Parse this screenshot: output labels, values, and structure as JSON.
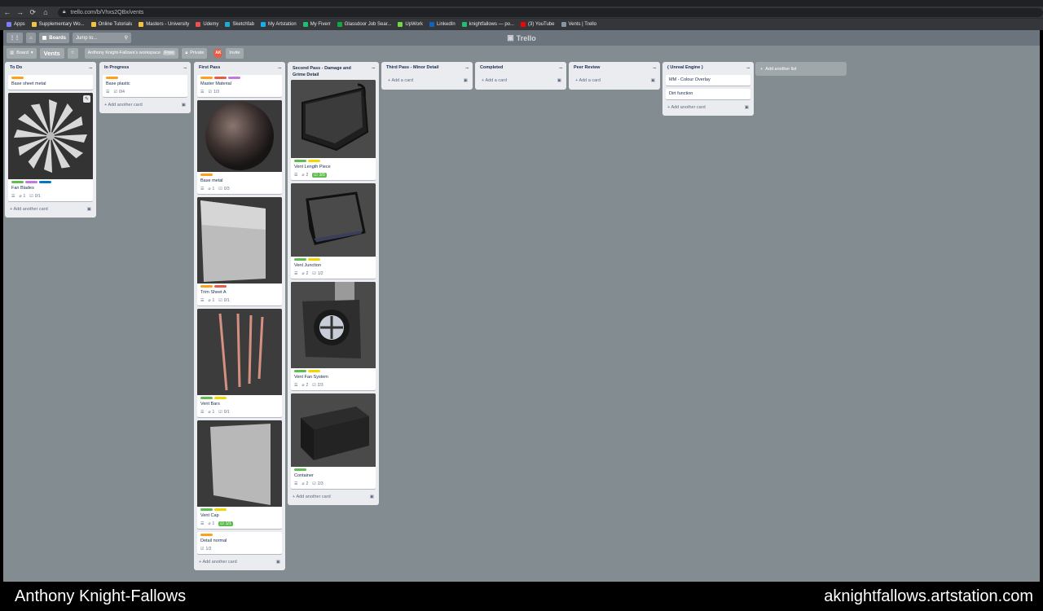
{
  "browser": {
    "url": "trello.com/b/Vhxs2QBx/vents",
    "bookmarks": [
      {
        "label": "Apps",
        "color": "#7d7dff"
      },
      {
        "label": "Supplementary Wo...",
        "color": "#f4c242"
      },
      {
        "label": "Online Tutorials",
        "color": "#f4c242"
      },
      {
        "label": "Masters - University",
        "color": "#f4c242"
      },
      {
        "label": "Udemy",
        "color": "#ec5252"
      },
      {
        "label": "Sketchfab",
        "color": "#1caad9"
      },
      {
        "label": "My Artstation",
        "color": "#13aff0"
      },
      {
        "label": "My Fiverr",
        "color": "#1dbf73"
      },
      {
        "label": "Glassdoor Job Sear...",
        "color": "#0caa41"
      },
      {
        "label": "UpWork",
        "color": "#6fda44"
      },
      {
        "label": "LinkedIn",
        "color": "#0a66c2"
      },
      {
        "label": "knightfallows — po...",
        "color": "#1dbf73"
      },
      {
        "label": "(3) YouTube",
        "color": "#ff0000"
      },
      {
        "label": "Vents | Trello",
        "color": "#8a94a6"
      }
    ]
  },
  "header": {
    "boards_label": "Boards",
    "jump_placeholder": "Jump to...",
    "logo": "Trello"
  },
  "board_header": {
    "view_label": "Board",
    "board_name": "Vents",
    "workspace": "Anthony Knight-Fallows's workspace",
    "workspace_tag": "Free",
    "visibility": "Private",
    "avatar": "AK",
    "invite": "Invite",
    "add_list": "Add another list"
  },
  "colors": {
    "orange": "#ff9f1a",
    "red": "#eb5a46",
    "purple": "#c377e0",
    "blue": "#0079bf",
    "green": "#61bd4f",
    "yellow": "#f2d600"
  },
  "lists": [
    {
      "title": "To Do",
      "add": "Add another card",
      "cards": [
        {
          "title": "Base sheet metal",
          "labels": [
            "orange"
          ]
        },
        {
          "title": "Fan Blades",
          "labels": [
            "green",
            "purple",
            "blue"
          ],
          "cover": "fan",
          "desc": true,
          "attach": "1",
          "check": "0/1"
        }
      ]
    },
    {
      "title": "In Progress",
      "add": "Add another card",
      "cards": [
        {
          "title": "Base plastic",
          "labels": [
            "orange"
          ],
          "desc": true,
          "check": "0/4"
        }
      ]
    },
    {
      "title": "First Pass",
      "add": "Add another card",
      "cards": [
        {
          "title": "Master Material",
          "labels": [
            "orange",
            "red",
            "purple"
          ],
          "desc": true,
          "check": "1/3"
        },
        {
          "title": "Base metal",
          "labels": [
            "orange"
          ],
          "cover": "sphere",
          "desc": true,
          "attach": "1",
          "check": "0/3"
        },
        {
          "title": "Trim Sheet A",
          "labels": [
            "orange",
            "red"
          ],
          "cover": "plate",
          "desc": true,
          "attach": "1",
          "check": "0/1"
        },
        {
          "title": "Vent Bars",
          "labels": [
            "green",
            "yellow"
          ],
          "cover": "bars",
          "desc": true,
          "attach": "1",
          "check": "0/1"
        },
        {
          "title": "Vent Cap",
          "labels": [
            "green",
            "yellow"
          ],
          "cover": "cap",
          "desc": true,
          "attach": "1",
          "check": "1/1",
          "done": true
        },
        {
          "title": "Detail normal",
          "labels": [
            "orange"
          ],
          "check": "1/2"
        }
      ]
    },
    {
      "title": "Second Pass - Damage and Grime Detail",
      "add": "Add another card",
      "cards": [
        {
          "title": "Vent Length Piece",
          "labels": [
            "green",
            "yellow"
          ],
          "cover": "length",
          "desc": true,
          "attach": "2",
          "check": "3/3",
          "done": true
        },
        {
          "title": "Vent Junction",
          "labels": [
            "green",
            "yellow"
          ],
          "cover": "junction",
          "desc": true,
          "attach": "2",
          "check": "1/2"
        },
        {
          "title": "Vent Fan System",
          "labels": [
            "green",
            "yellow"
          ],
          "cover": "fansys",
          "desc": true,
          "attach": "2",
          "check": "2/3"
        },
        {
          "title": "Container",
          "labels": [
            "green"
          ],
          "cover": "container",
          "desc": true,
          "attach": "2",
          "check": "2/3"
        }
      ]
    },
    {
      "title": "Third Pass - Minor Detail",
      "add": "Add a card",
      "cards": []
    },
    {
      "title": "Completed",
      "add": "Add a card",
      "cards": []
    },
    {
      "title": "Peer Review",
      "add": "Add a card",
      "cards": []
    },
    {
      "title": "( Unreal Engine )",
      "add": "Add another card",
      "cards": [
        {
          "title": "MM - Colour Overlay",
          "labels": []
        },
        {
          "title": "Dirt function",
          "labels": []
        }
      ]
    }
  ],
  "footer": {
    "name": "Anthony Knight-Fallows",
    "site": "aknightfallows.artstation.com"
  }
}
